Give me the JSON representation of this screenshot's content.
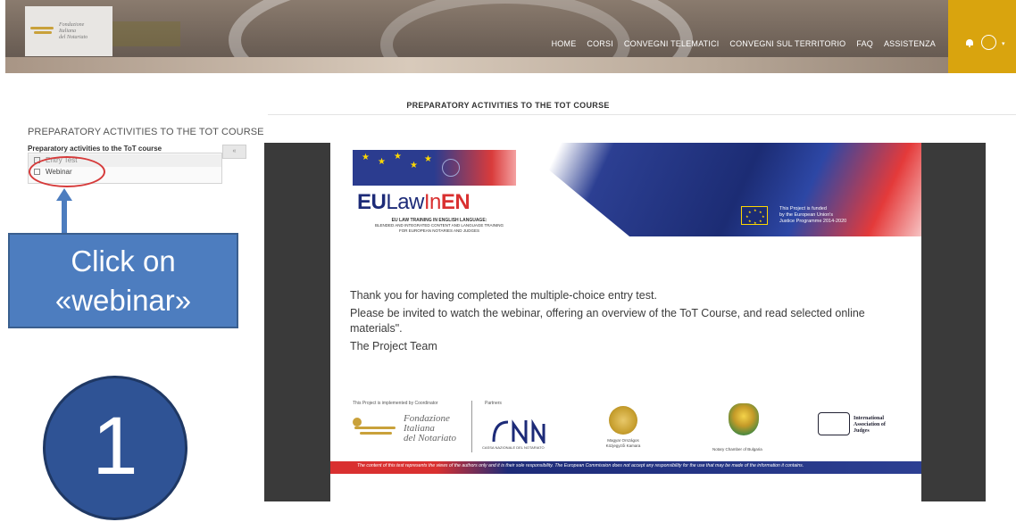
{
  "header": {
    "logo_lines": [
      "Fondazione",
      "Italiana",
      "del Notariato"
    ],
    "nav_items": [
      "HOME",
      "CORSI",
      "CONVEGNI TELEMATICI",
      "CONVEGNI SUL TERRITORIO",
      "FAQ",
      "ASSISTENZA"
    ],
    "accent_color": "#d9a40e"
  },
  "page_title": "PREPARATORY ACTIVITIES TO THE TOT COURSE",
  "sidebar": {
    "heading": "PREPARATORY ACTIVITIES TO THE TOT COURSE",
    "subheading": "Preparatory activities to the ToT course",
    "items": [
      {
        "label": "Entry Test",
        "checked": false
      },
      {
        "label": "Webinar",
        "checked": false
      }
    ],
    "toggle_label": "«"
  },
  "annotation": {
    "callout_line1": "Click on",
    "callout_line2": "«webinar»",
    "step_number": "1",
    "highlight_color": "#d63a3a",
    "callout_color": "#4d7dbf"
  },
  "document": {
    "logo_eu": "EU",
    "logo_law": "Law",
    "logo_in": "In",
    "logo_en": "EN",
    "caption_line1": "EU LAW TRAINING IN ENGLISH LANGUAGE:",
    "caption_line2": "BLENDED AND INTEGRATED CONTENT AND LANGUAGE TRAINING",
    "caption_line3": "FOR EUROPEAN NOTARIES AND JUDGES",
    "funded_line1": "This Project is funded",
    "funded_line2": "by the European Union's",
    "funded_line3": "Justice Programme 2014-2020",
    "message_line1": "Thank you for having completed the multiple-choice entry test.",
    "message_line2": "Please be invited to watch the webinar, offering an overview of the ToT Course, and read selected online materials\".",
    "message_line3": "The Project Team",
    "implemented_label": "This Project is implemented by Coordinator",
    "partners_label": "Partners",
    "coordinator_lines": [
      "Fondazione",
      "Italiana",
      "del Notariato"
    ],
    "cnn_caption": "CASSA NAZIONALE DEL NOTARIATO",
    "hu_caption_line1": "Magyar Országos",
    "hu_caption_line2": "Közjegyzői Kamara",
    "bg_caption": "Notary Chamber of Bulgaria",
    "iaj_lines": [
      "International",
      "Association of",
      "Judges"
    ],
    "disclaimer": "The content of this test represents the views of the authors only and it is their sole responsibility. The European Commission does not accept any responsibility for the use that may be made of the information it contains."
  }
}
